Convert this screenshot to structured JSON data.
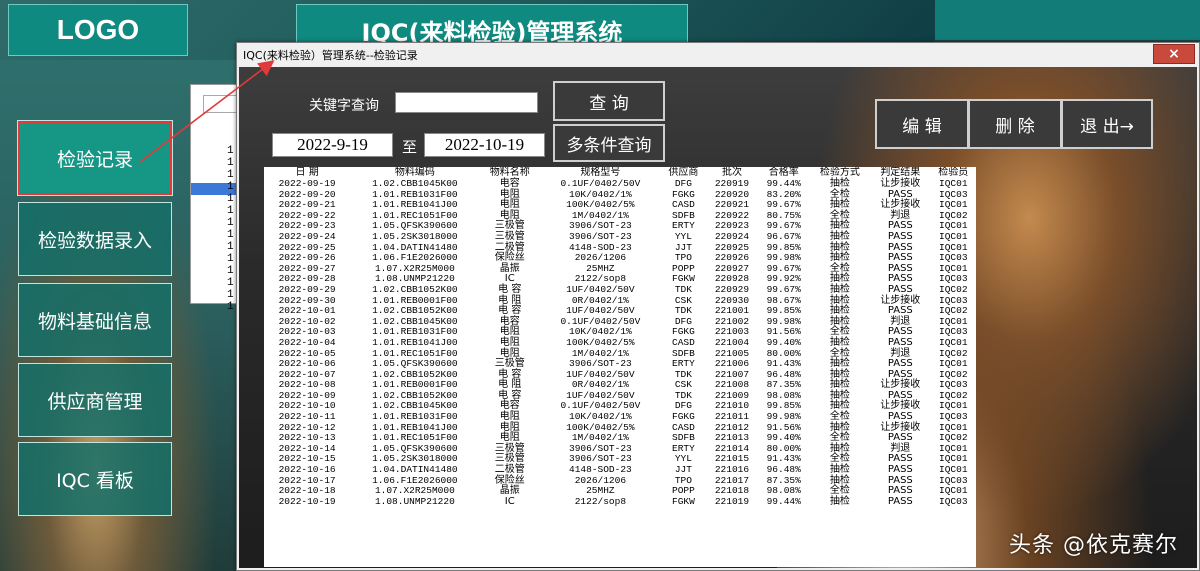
{
  "header": {
    "logo": "LOGO",
    "title": "IQC(来料检验)管理系统"
  },
  "sidebar": {
    "items": [
      {
        "label": "检验记录"
      },
      {
        "label": "检验数据录入"
      },
      {
        "label": "物料基础信息"
      },
      {
        "label": "供应商管理"
      },
      {
        "label": "IQC 看板"
      }
    ]
  },
  "underlying_panel": {
    "lines": [
      "1",
      "1",
      "1",
      "1",
      "1",
      "1",
      "1",
      "1",
      "1",
      "1",
      "1",
      "1",
      "1",
      "1"
    ]
  },
  "window": {
    "title": "IQC(来料检验）管理系统--检验记录",
    "close_icon": "×",
    "keyword_label": "关键字查询",
    "keyword_value": "",
    "search_button": "查 询",
    "start_date": "2022-9-19",
    "to_label": "至",
    "end_date": "2022-10-19",
    "multi_search_button": "多条件查询",
    "edit_button": "编 辑",
    "delete_button": "删 除",
    "exit_button": "退 出→"
  },
  "table": {
    "columns": [
      "日 期",
      "物料编码",
      "物料名称",
      "规格型号",
      "供应商",
      "批次",
      "合格率",
      "检验方式",
      "判定结果",
      "检验员"
    ],
    "rows": [
      [
        "2022-09-19",
        "1.02.CBB1045K00",
        "电容",
        "0.1UF/0402/50V",
        "DFG",
        "220919",
        "99.44%",
        "抽检",
        "让步接收",
        "IQC01"
      ],
      [
        "2022-09-20",
        "1.01.REB1031F00",
        "电阻",
        "10K/0402/1%",
        "FGKG",
        "220920",
        "83.20%",
        "全检",
        "PASS",
        "IQC03"
      ],
      [
        "2022-09-21",
        "1.01.REB1041J00",
        "电阻",
        "100K/0402/5%",
        "CASD",
        "220921",
        "99.67%",
        "抽检",
        "让步接收",
        "IQC01"
      ],
      [
        "2022-09-22",
        "1.01.REC1051F00",
        "电阻",
        "1M/0402/1%",
        "SDFB",
        "220922",
        "80.75%",
        "全检",
        "判退",
        "IQC02"
      ],
      [
        "2022-09-23",
        "1.05.QFSK390600",
        "三极管",
        "3906/SOT-23",
        "ERTY",
        "220923",
        "99.67%",
        "抽检",
        "PASS",
        "IQC01"
      ],
      [
        "2022-09-24",
        "1.05.2SK3018000",
        "三极管",
        "3906/SOT-23",
        "YYL",
        "220924",
        "96.67%",
        "抽检",
        "PASS",
        "IQC01"
      ],
      [
        "2022-09-25",
        "1.04.DATIN41480",
        "二极管",
        "4148-SOD-23",
        "JJT",
        "220925",
        "99.85%",
        "抽检",
        "PASS",
        "IQC01"
      ],
      [
        "2022-09-26",
        "1.06.F1E2026000",
        "保险丝",
        "2026/1206",
        "TPO",
        "220926",
        "99.98%",
        "抽检",
        "PASS",
        "IQC03"
      ],
      [
        "2022-09-27",
        "1.07.X2R25M000",
        "晶振",
        "25MHZ",
        "POPP",
        "220927",
        "99.67%",
        "全检",
        "PASS",
        "IQC01"
      ],
      [
        "2022-09-28",
        "1.08.UNMP21220",
        "IC",
        "2122/sop8",
        "FGKW",
        "220928",
        "99.92%",
        "抽检",
        "PASS",
        "IQC03"
      ],
      [
        "2022-09-29",
        "1.02.CBB1052K00",
        "电 容",
        "1UF/0402/50V",
        "TDK",
        "220929",
        "99.67%",
        "抽检",
        "PASS",
        "IQC02"
      ],
      [
        "2022-09-30",
        "1.01.REB0001F00",
        "电 阻",
        "0R/0402/1%",
        "CSK",
        "220930",
        "98.67%",
        "抽检",
        "让步接收",
        "IQC03"
      ],
      [
        "2022-10-01",
        "1.02.CBB1052K00",
        "电 容",
        "1UF/0402/50V",
        "TDK",
        "221001",
        "99.85%",
        "抽检",
        "PASS",
        "IQC02"
      ],
      [
        "2022-10-02",
        "1.02.CBB1045K00",
        "电容",
        "0.1UF/0402/50V",
        "DFG",
        "221002",
        "99.98%",
        "抽检",
        "判退",
        "IQC01"
      ],
      [
        "2022-10-03",
        "1.01.REB1031F00",
        "电阻",
        "10K/0402/1%",
        "FGKG",
        "221003",
        "91.56%",
        "全检",
        "PASS",
        "IQC03"
      ],
      [
        "2022-10-04",
        "1.01.REB1041J00",
        "电阻",
        "100K/0402/5%",
        "CASD",
        "221004",
        "99.40%",
        "抽检",
        "PASS",
        "IQC01"
      ],
      [
        "2022-10-05",
        "1.01.REC1051F00",
        "电阻",
        "1M/0402/1%",
        "SDFB",
        "221005",
        "80.00%",
        "全检",
        "判退",
        "IQC02"
      ],
      [
        "2022-10-06",
        "1.05.QFSK390600",
        "三极管",
        "3906/SOT-23",
        "ERTY",
        "221006",
        "91.43%",
        "抽检",
        "PASS",
        "IQC01"
      ],
      [
        "2022-10-07",
        "1.02.CBB1052K00",
        "电 容",
        "1UF/0402/50V",
        "TDK",
        "221007",
        "96.48%",
        "抽检",
        "PASS",
        "IQC02"
      ],
      [
        "2022-10-08",
        "1.01.REB0001F00",
        "电 阻",
        "0R/0402/1%",
        "CSK",
        "221008",
        "87.35%",
        "抽检",
        "让步接收",
        "IQC03"
      ],
      [
        "2022-10-09",
        "1.02.CBB1052K00",
        "电 容",
        "1UF/0402/50V",
        "TDK",
        "221009",
        "98.08%",
        "抽检",
        "PASS",
        "IQC02"
      ],
      [
        "2022-10-10",
        "1.02.CBB1045K00",
        "电容",
        "0.1UF/0402/50V",
        "DFG",
        "221010",
        "99.85%",
        "抽检",
        "让步接收",
        "IQC01"
      ],
      [
        "2022-10-11",
        "1.01.REB1031F00",
        "电阻",
        "10K/0402/1%",
        "FGKG",
        "221011",
        "99.98%",
        "全检",
        "PASS",
        "IQC03"
      ],
      [
        "2022-10-12",
        "1.01.REB1041J00",
        "电阻",
        "100K/0402/5%",
        "CASD",
        "221012",
        "91.56%",
        "抽检",
        "让步接收",
        "IQC01"
      ],
      [
        "2022-10-13",
        "1.01.REC1051F00",
        "电阻",
        "1M/0402/1%",
        "SDFB",
        "221013",
        "99.40%",
        "全检",
        "PASS",
        "IQC02"
      ],
      [
        "2022-10-14",
        "1.05.QFSK390600",
        "三极管",
        "3906/SOT-23",
        "ERTY",
        "221014",
        "80.00%",
        "抽检",
        "判退",
        "IQC01"
      ],
      [
        "2022-10-15",
        "1.05.2SK3018000",
        "三极管",
        "3906/SOT-23",
        "YYL",
        "221015",
        "91.43%",
        "全检",
        "PASS",
        "IQC01"
      ],
      [
        "2022-10-16",
        "1.04.DATIN41480",
        "二极管",
        "4148-SOD-23",
        "JJT",
        "221016",
        "96.48%",
        "抽检",
        "PASS",
        "IQC01"
      ],
      [
        "2022-10-17",
        "1.06.F1E2026000",
        "保险丝",
        "2026/1206",
        "TPO",
        "221017",
        "87.35%",
        "抽检",
        "PASS",
        "IQC03"
      ],
      [
        "2022-10-18",
        "1.07.X2R25M000",
        "晶振",
        "25MHZ",
        "POPP",
        "221018",
        "98.08%",
        "全检",
        "PASS",
        "IQC01"
      ],
      [
        "2022-10-19",
        "1.08.UNMP21220",
        "IC",
        "2122/sop8",
        "FGKW",
        "221019",
        "99.44%",
        "抽检",
        "PASS",
        "IQC03"
      ]
    ]
  },
  "watermark": "头条 @依克赛尔",
  "colors": {
    "teal": "#0f8a80",
    "annotation_red": "#e03a3a"
  }
}
